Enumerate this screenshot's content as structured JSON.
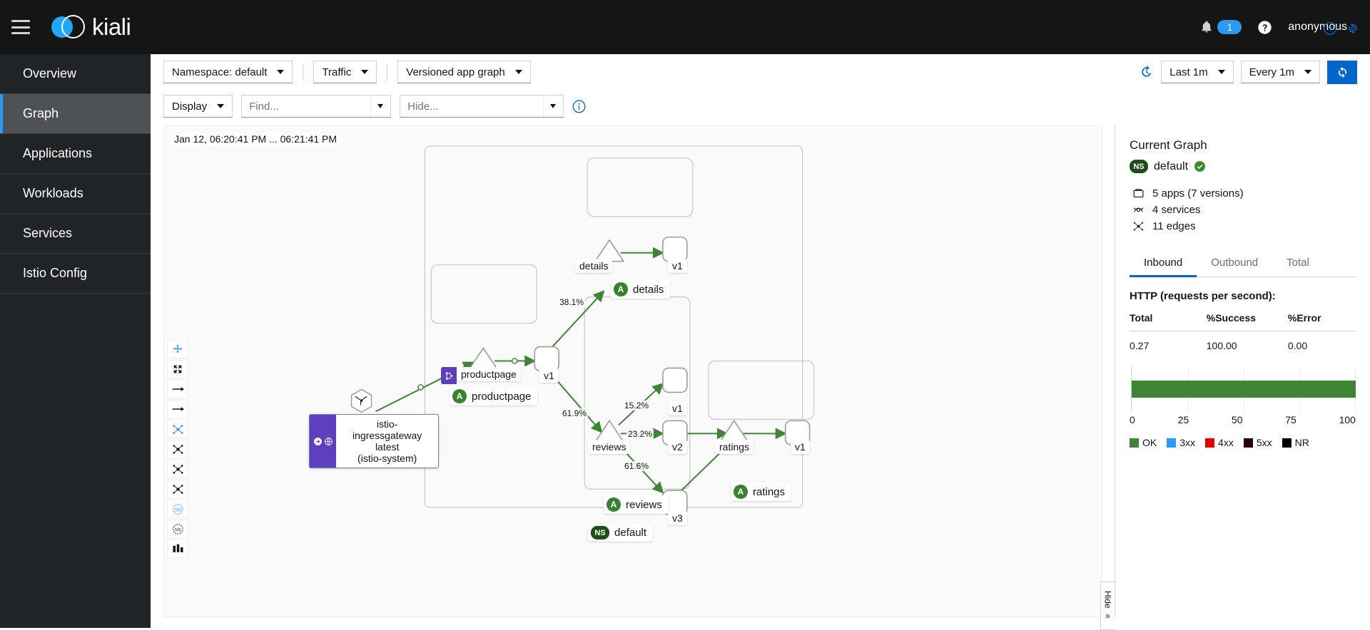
{
  "masthead": {
    "menu_icon": "hamburger-icon",
    "brand_name": "kiali",
    "bell_icon": "bell-icon",
    "notification_count": "1",
    "help_icon": "help-circle-icon",
    "user": "anonymous"
  },
  "sidebar": {
    "items": [
      {
        "label": "Overview",
        "active": false
      },
      {
        "label": "Graph",
        "active": true
      },
      {
        "label": "Applications",
        "active": false
      },
      {
        "label": "Workloads",
        "active": false
      },
      {
        "label": "Services",
        "active": false
      },
      {
        "label": "Istio Config",
        "active": false
      }
    ]
  },
  "toolbar": {
    "namespace_label": "Namespace:",
    "namespace_value": "default",
    "traffic_label": "Traffic",
    "graph_type": "Versioned app graph",
    "history_icon": "history-icon",
    "time_range": "Last 1m",
    "refresh_interval": "Every 1m",
    "refresh_icon": "refresh-icon",
    "display_label": "Display",
    "find_placeholder": "Find...",
    "find_value": "",
    "hide_placeholder": "Hide...",
    "hide_value": "",
    "info_icon": "info-circle-icon"
  },
  "graph": {
    "timestamp": "Jan 12, 06:20:41 PM ... 06:21:41 PM",
    "help_icon": "help-circle-icon",
    "reset_icon": "reset-view-icon",
    "tools": [
      {
        "name": "zoom-fit-icon",
        "active": true
      },
      {
        "name": "expand-icon",
        "active": false
      },
      {
        "name": "arrow-right-icon",
        "active": false
      },
      {
        "name": "arrow-right-alt-icon",
        "active": false
      },
      {
        "name": "layout-dagre-icon",
        "active": true
      },
      {
        "name": "layout-grid-icon",
        "active": false
      },
      {
        "name": "layout-concentric-icon",
        "active": false
      },
      {
        "name": "layout-breadthfirst-icon",
        "active": false
      },
      {
        "name": "namespace-box-icon",
        "active": true
      },
      {
        "name": "namespace-box-alt-icon",
        "active": false
      },
      {
        "name": "legend-icon",
        "active": false
      }
    ],
    "namespace_box_label": "default",
    "namespace_box_badge": "NS",
    "nodes": [
      {
        "id": "ingressgateway",
        "type": "hexagon",
        "title": "istio-ingressgateway",
        "version": "latest",
        "namespace": "(istio-system)"
      },
      {
        "id": "details-service",
        "type": "triangle",
        "label": "details"
      },
      {
        "id": "details-v1",
        "type": "square",
        "label": "v1"
      },
      {
        "id": "details-group",
        "badge": "A",
        "label": "details"
      },
      {
        "id": "productpage-service",
        "type": "triangle",
        "label": "productpage",
        "vs_badge": "virtual-service-icon"
      },
      {
        "id": "productpage-v1",
        "type": "square",
        "label": "v1"
      },
      {
        "id": "productpage-group",
        "badge": "A",
        "label": "productpage"
      },
      {
        "id": "reviews-service",
        "type": "triangle",
        "label": "reviews"
      },
      {
        "id": "reviews-v1",
        "type": "square",
        "label": "v1"
      },
      {
        "id": "reviews-v2",
        "type": "square",
        "label": "v2"
      },
      {
        "id": "reviews-v3",
        "type": "square",
        "label": "v3"
      },
      {
        "id": "reviews-group",
        "badge": "A",
        "label": "reviews"
      },
      {
        "id": "ratings-service",
        "type": "triangle",
        "label": "ratings"
      },
      {
        "id": "ratings-v1",
        "type": "square",
        "label": "v1"
      },
      {
        "id": "ratings-group",
        "badge": "A",
        "label": "ratings"
      }
    ],
    "edge_labels": [
      {
        "id": "e-details",
        "value": "38.1%"
      },
      {
        "id": "e-reviews",
        "value": "61.9%"
      },
      {
        "id": "e-reviews-v1",
        "value": "15.2%"
      },
      {
        "id": "e-reviews-v2",
        "value": "23.2%"
      },
      {
        "id": "e-reviews-v3",
        "value": "61.6%"
      }
    ]
  },
  "side_panel": {
    "title": "Current Graph",
    "ns_badge": "NS",
    "ns_name": "default",
    "health_icon": "check-circle-icon",
    "stats": [
      {
        "icon": "apps-icon",
        "text": "5 apps (7 versions)"
      },
      {
        "icon": "services-icon",
        "text": "4 services"
      },
      {
        "icon": "edges-icon",
        "text": "11 edges"
      }
    ],
    "tabs": [
      {
        "label": "Inbound",
        "active": true
      },
      {
        "label": "Outbound",
        "active": false
      },
      {
        "label": "Total",
        "active": false
      }
    ],
    "metrics_title": "HTTP (requests per second):",
    "table": {
      "headers": [
        "Total",
        "%Success",
        "%Error"
      ],
      "rows": [
        [
          "0.27",
          "100.00",
          "0.00"
        ]
      ]
    },
    "hide_tab_label": "Hide",
    "hide_tab_icon": "double-chevron-right-icon"
  },
  "chart_data": {
    "type": "bar",
    "orientation": "horizontal",
    "categories": [
      "OK"
    ],
    "series": [
      {
        "name": "OK",
        "values": [
          100
        ],
        "color": "#3e8635"
      },
      {
        "name": "3xx",
        "values": [
          0
        ],
        "color": "#2b9af3"
      },
      {
        "name": "4xx",
        "values": [
          0
        ],
        "color": "#e00000"
      },
      {
        "name": "5xx",
        "values": [
          0
        ],
        "color": "#2c0000"
      },
      {
        "name": "NR",
        "values": [
          0
        ],
        "color": "#000000"
      }
    ],
    "title": "",
    "xlabel": "",
    "ylabel": "",
    "xlim": [
      0,
      100
    ],
    "xticks": [
      "0",
      "25",
      "50",
      "75",
      "100"
    ],
    "grid": true,
    "legend_position": "bottom",
    "legend": [
      "OK",
      "3xx",
      "4xx",
      "5xx",
      "NR"
    ]
  }
}
